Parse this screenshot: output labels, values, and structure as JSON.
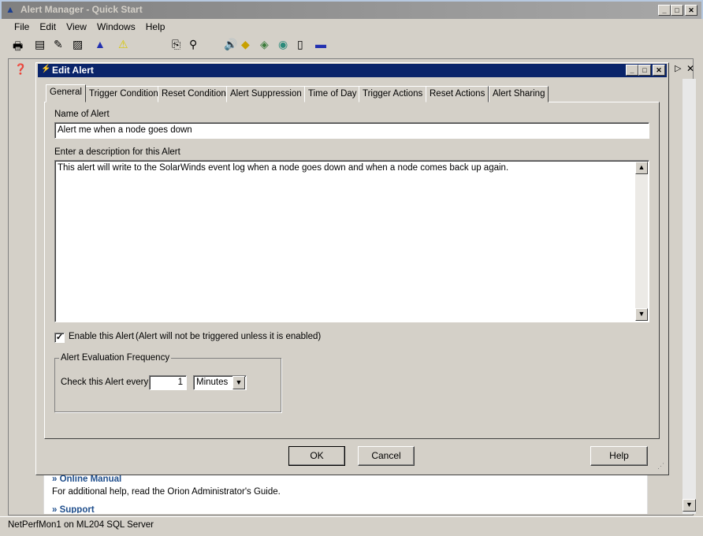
{
  "app": {
    "title": "Alert Manager - Quick Start",
    "menu": [
      "File",
      "Edit",
      "View",
      "Windows",
      "Help"
    ],
    "status": "NetPerfMon1 on ML204 SQL Server",
    "content": {
      "online_manual": "» Online Manual",
      "online_manual_desc": "For additional help, read the Orion Administrator's Guide.",
      "support": "» Support"
    }
  },
  "dialog": {
    "title": "Edit Alert",
    "tabs": [
      "General",
      "Trigger Condition",
      "Reset Condition",
      "Alert Suppression",
      "Time of Day",
      "Trigger Actions",
      "Reset Actions",
      "Alert Sharing"
    ],
    "active_tab": "General",
    "name_label": "Name of Alert",
    "name_value": "Alert me when a node goes down",
    "desc_label": "Enter a description for this Alert",
    "desc_value": "This alert will write to the SolarWinds event log when a node goes down and when a node comes back up again.",
    "enable_label": "Enable this Alert",
    "enable_note": "(Alert will not be triggered unless it is enabled)",
    "enabled": true,
    "freq_group": "Alert Evaluation Frequency",
    "freq_label": "Check this Alert every",
    "freq_value": "1",
    "freq_unit": "Minutes",
    "ok": "OK",
    "cancel": "Cancel",
    "help": "Help"
  }
}
